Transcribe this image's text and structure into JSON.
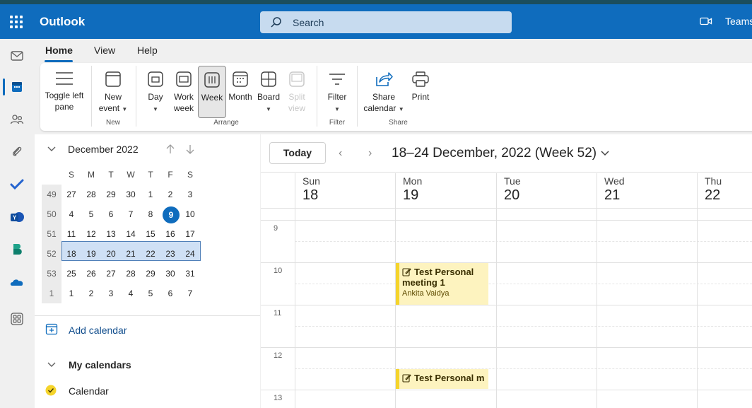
{
  "app": {
    "name": "Outlook",
    "search_placeholder": "Search",
    "teams_label": "Teams",
    "colors": {
      "brand": "#0f6cbd",
      "event_bg": "#fdf3bf",
      "event_bar": "#f5d42b",
      "calendar_dot": "#f5d42b"
    }
  },
  "rail": {
    "items": [
      "mail-icon",
      "calendar-icon",
      "people-icon",
      "attachment-icon",
      "todo-icon",
      "yammer-icon",
      "bookings-icon",
      "onedrive-icon",
      "apps-icon"
    ],
    "selected": "calendar-icon"
  },
  "tabs": [
    {
      "label": "Home",
      "active": true
    },
    {
      "label": "View",
      "active": false
    },
    {
      "label": "Help",
      "active": false
    }
  ],
  "ribbon": {
    "toggle": "Toggle left pane",
    "new_event": "New event",
    "day": "Day",
    "work_week": "Work week",
    "week": "Week",
    "month": "Month",
    "board": "Board",
    "split_view": "Split view",
    "filter": "Filter",
    "share_calendar": "Share calendar",
    "print": "Print",
    "groups": {
      "new": "New",
      "arrange": "Arrange",
      "filter": "Filter",
      "share": "Share"
    }
  },
  "mini_calendar": {
    "title": "December 2022",
    "dow": [
      "S",
      "M",
      "T",
      "W",
      "T",
      "F",
      "S"
    ],
    "weeks": [
      {
        "wk": "49",
        "days": [
          "27",
          "28",
          "29",
          "30",
          "1",
          "2",
          "3"
        ]
      },
      {
        "wk": "50",
        "days": [
          "4",
          "5",
          "6",
          "7",
          "8",
          "9",
          "10"
        ]
      },
      {
        "wk": "51",
        "days": [
          "11",
          "12",
          "13",
          "14",
          "15",
          "16",
          "17"
        ]
      },
      {
        "wk": "52",
        "days": [
          "18",
          "19",
          "20",
          "21",
          "22",
          "23",
          "24"
        ]
      },
      {
        "wk": "53",
        "days": [
          "25",
          "26",
          "27",
          "28",
          "29",
          "30",
          "31"
        ]
      },
      {
        "wk": "1",
        "days": [
          "1",
          "2",
          "3",
          "4",
          "5",
          "6",
          "7"
        ]
      }
    ],
    "today": "9",
    "selected_week": "52"
  },
  "leftpane": {
    "add_calendar": "Add calendar",
    "my_calendars": "My calendars",
    "calendar_item": "Calendar"
  },
  "calendar": {
    "today_button": "Today",
    "range_title": "18–24 December, 2022 (Week 52)",
    "days": [
      {
        "name": "Sun",
        "date": "18"
      },
      {
        "name": "Mon",
        "date": "19"
      },
      {
        "name": "Tue",
        "date": "20"
      },
      {
        "name": "Wed",
        "date": "21"
      },
      {
        "name": "Thu",
        "date": "22"
      }
    ],
    "hours": [
      "9",
      "10",
      "11",
      "12",
      "13"
    ],
    "events": [
      {
        "title_line1": "Test Personal",
        "title_line2": "meeting 1",
        "organizer": "Ankita Vaidya"
      },
      {
        "title_line1": "Test Personal m"
      }
    ]
  }
}
